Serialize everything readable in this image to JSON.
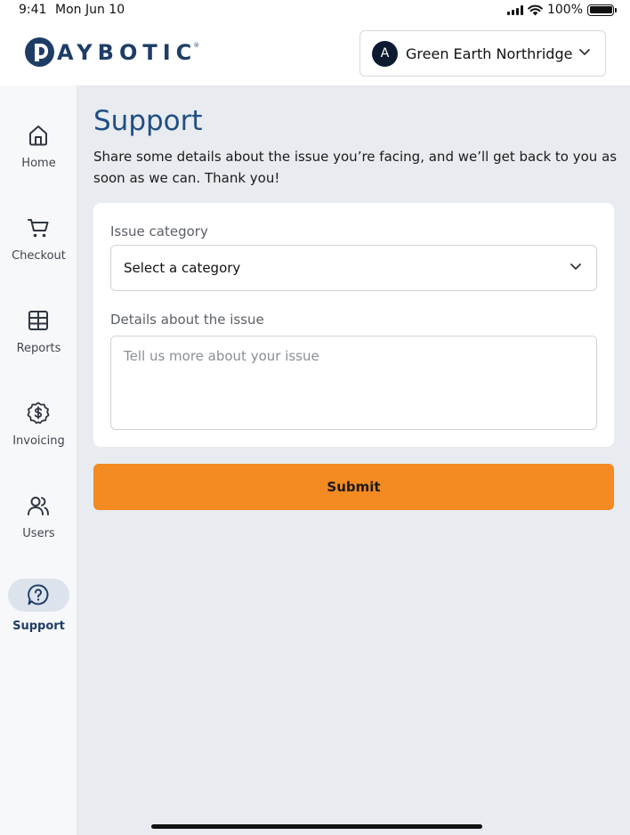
{
  "status_bar": {
    "time": "9:41",
    "date": "Mon Jun 10",
    "battery": "100%"
  },
  "header": {
    "logo_text": "AYBOTIC",
    "account": {
      "avatar_initial": "A",
      "name": "Green Earth Northridge"
    }
  },
  "sidebar": {
    "items": [
      {
        "label": "Home",
        "icon": "home-icon",
        "active": false
      },
      {
        "label": "Checkout",
        "icon": "cart-icon",
        "active": false
      },
      {
        "label": "Reports",
        "icon": "table-icon",
        "active": false
      },
      {
        "label": "Invoicing",
        "icon": "dollar-badge-icon",
        "active": false
      },
      {
        "label": "Users",
        "icon": "users-icon",
        "active": false
      },
      {
        "label": "Support",
        "icon": "help-chat-icon",
        "active": true
      }
    ]
  },
  "main": {
    "title": "Support",
    "description": "Share some details about the issue you’re facing, and we’ll get back to you as soon as we can. Thank you!",
    "form": {
      "category_label": "Issue category",
      "category_value": "Select a category",
      "details_label": "Details about the issue",
      "details_placeholder": "Tell us more about your issue"
    },
    "submit_label": "Submit"
  },
  "colors": {
    "brand": "#1e3d66",
    "title": "#1f4f83",
    "accent": "#f38a22",
    "background": "#e8ebef"
  }
}
